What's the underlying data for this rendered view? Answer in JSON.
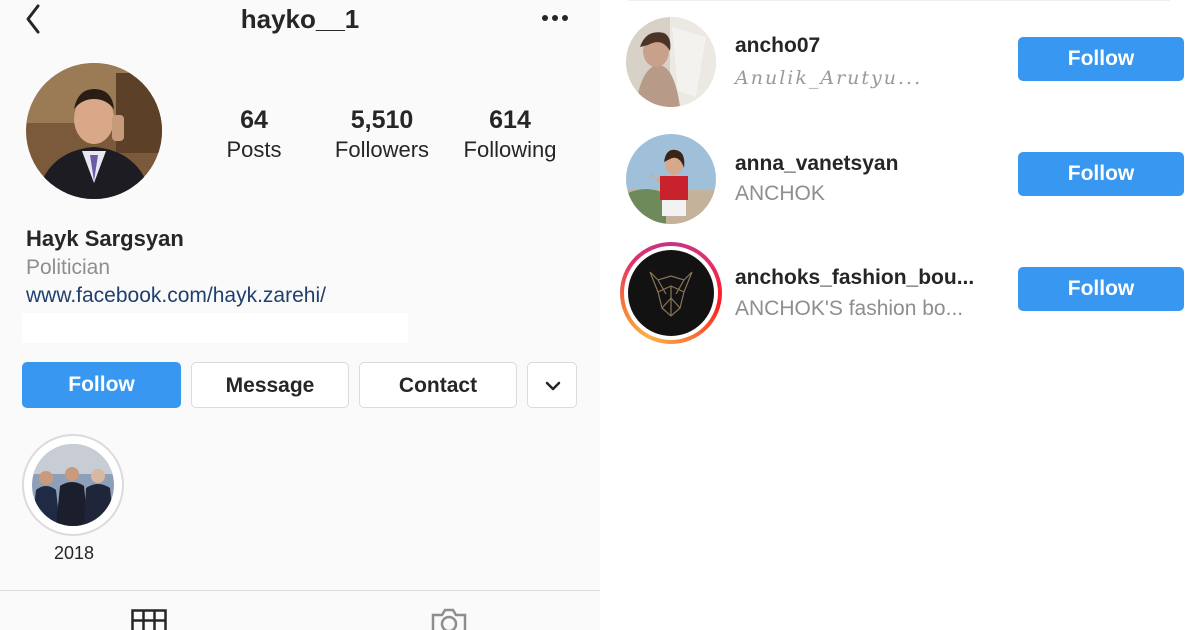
{
  "profile": {
    "username": "hayko__1",
    "full_name": "Hayk Sargsyan",
    "category": "Politician",
    "website": "www.facebook.com/hayk.zarehi/"
  },
  "stats": [
    {
      "value": "64",
      "label": "Posts"
    },
    {
      "value": "5,510",
      "label": "Followers"
    },
    {
      "value": "614",
      "label": "Following"
    }
  ],
  "actions": {
    "follow_label": "Follow",
    "message_label": "Message",
    "contact_label": "Contact"
  },
  "highlights": [
    {
      "label": "2018"
    }
  ],
  "icons": {
    "back": "back-chevron-icon",
    "more": "more-options-icon",
    "dropdown": "chevron-down-icon",
    "grid": "grid-icon",
    "tagged": "tagged-photos-icon"
  },
  "suggestions": [
    {
      "username": "ancho07",
      "subtitle": "Anulik_Arutyu...",
      "button": "Follow"
    },
    {
      "username": "anna_vanetsyan",
      "subtitle": "ANCHOK",
      "button": "Follow"
    },
    {
      "username": "anchoks_fashion_bou...",
      "subtitle": "ANCHOK'S fashion bo...",
      "button": "Follow"
    }
  ],
  "colors": {
    "accent": "#3897f0",
    "link": "#1f3f6e",
    "muted": "#8e8e8e"
  }
}
